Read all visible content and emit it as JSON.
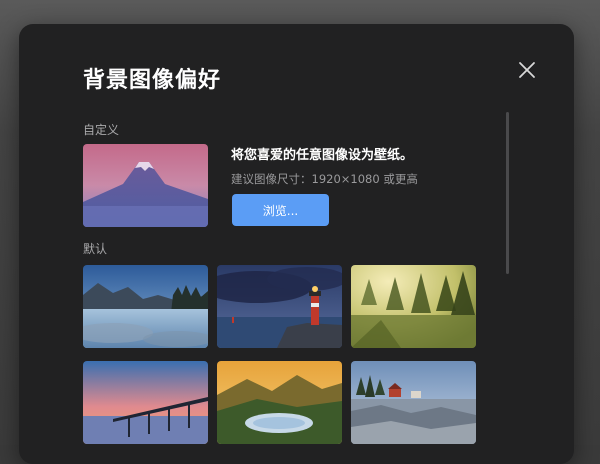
{
  "dialog": {
    "title": "背景图像偏好"
  },
  "custom": {
    "section_label": "自定义",
    "headline": "将您喜爱的任意图像设为壁纸。",
    "hint": "建议图像尺寸：1920×1080 或更高",
    "browse_label": "浏览..."
  },
  "defaults": {
    "section_label": "默认",
    "thumbnails": [
      {
        "name": "lake-mountains"
      },
      {
        "name": "lighthouse-night"
      },
      {
        "name": "misty-forest"
      },
      {
        "name": "pier-sunset"
      },
      {
        "name": "valley-lake"
      },
      {
        "name": "rocky-shore-village"
      }
    ]
  },
  "colors": {
    "dialog_bg": "#212122",
    "accent": "#5b9df5",
    "title_text": "#ffffff",
    "muted_text": "#a9a9ab"
  },
  "icons": {
    "close": "close-icon"
  }
}
